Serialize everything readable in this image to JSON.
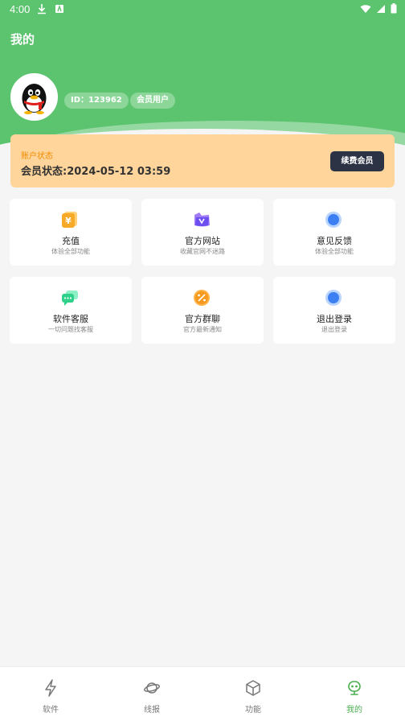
{
  "status_bar": {
    "time": "4:00"
  },
  "header": {
    "title": "我的",
    "user_id": "ID：123962",
    "member_badge": "会员用户"
  },
  "account": {
    "label": "账户状态",
    "status": "会员状态:2024-05-12 03:59",
    "renew_label": "续费会员"
  },
  "colors": {
    "header_green": "#5cc46f",
    "card_orange": "#ffd59b",
    "accent_green": "#4caf50",
    "renew_dark": "#2c3345"
  },
  "features": [
    {
      "title": "充值",
      "subtitle": "体验全部功能",
      "icon": "yuan-coin-icon"
    },
    {
      "title": "官方网站",
      "subtitle": "收藏官网不迷路",
      "icon": "website-icon"
    },
    {
      "title": "意见反馈",
      "subtitle": "体验全部功能",
      "icon": "feedback-icon"
    },
    {
      "title": "软件客服",
      "subtitle": "一切问题找客服",
      "icon": "chat-icon"
    },
    {
      "title": "官方群聊",
      "subtitle": "官方最新通知",
      "icon": "group-chat-icon"
    },
    {
      "title": "退出登录",
      "subtitle": "退出登录",
      "icon": "logout-icon"
    }
  ],
  "tabs": [
    {
      "label": "软件",
      "icon": "lightning-icon"
    },
    {
      "label": "线报",
      "icon": "planet-icon"
    },
    {
      "label": "功能",
      "icon": "cube-icon"
    },
    {
      "label": "我的",
      "icon": "robot-icon",
      "active": true
    }
  ]
}
